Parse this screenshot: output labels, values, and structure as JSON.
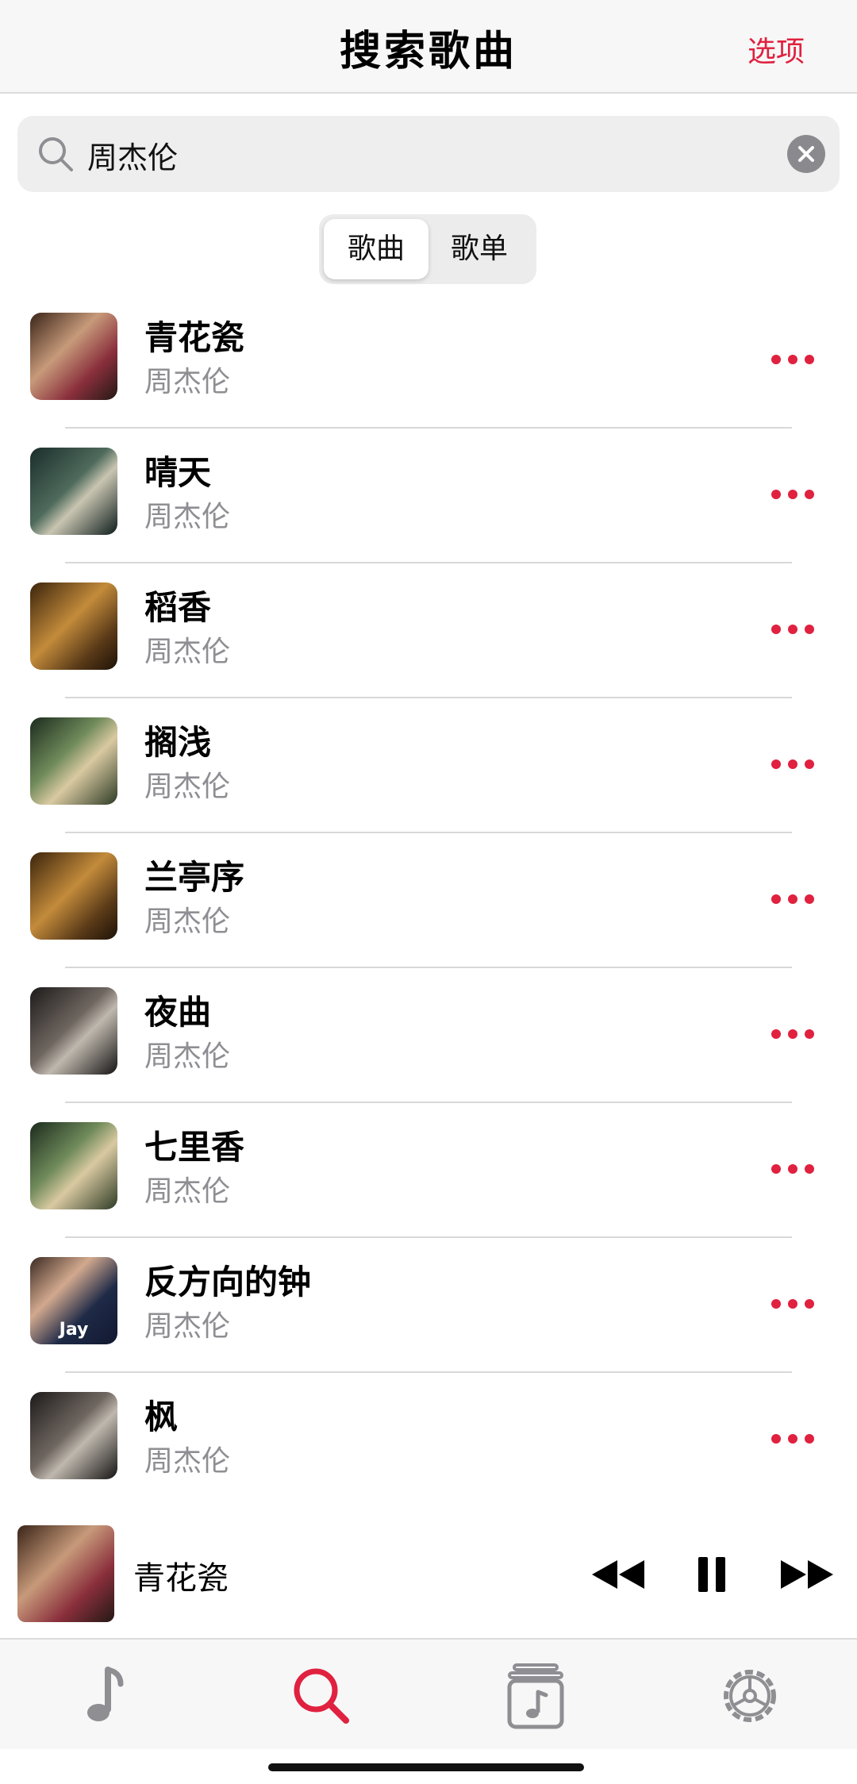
{
  "header": {
    "title": "搜索歌曲",
    "options_label": "选项"
  },
  "search": {
    "query": "周杰伦"
  },
  "segments": {
    "songs_label": "歌曲",
    "playlists_label": "歌单",
    "active": "歌曲"
  },
  "songs": [
    {
      "title": "青花瓷",
      "artist": "周杰伦",
      "cover": "c0",
      "cover_text": ""
    },
    {
      "title": "晴天",
      "artist": "周杰伦",
      "cover": "c1",
      "cover_text": ""
    },
    {
      "title": "稻香",
      "artist": "周杰伦",
      "cover": "c2",
      "cover_text": ""
    },
    {
      "title": "搁浅",
      "artist": "周杰伦",
      "cover": "c3",
      "cover_text": ""
    },
    {
      "title": "兰亭序",
      "artist": "周杰伦",
      "cover": "c2",
      "cover_text": ""
    },
    {
      "title": "夜曲",
      "artist": "周杰伦",
      "cover": "c4",
      "cover_text": ""
    },
    {
      "title": "七里香",
      "artist": "周杰伦",
      "cover": "c3",
      "cover_text": ""
    },
    {
      "title": "反方向的钟",
      "artist": "周杰伦",
      "cover": "c5",
      "cover_text": "Jay"
    },
    {
      "title": "枫",
      "artist": "周杰伦",
      "cover": "c4",
      "cover_text": ""
    }
  ],
  "now_playing": {
    "title": "青花瓷"
  },
  "tabs": [
    {
      "icon": "music-note-icon",
      "active": false
    },
    {
      "icon": "search-icon",
      "active": true
    },
    {
      "icon": "playlist-icon",
      "active": false
    },
    {
      "icon": "settings-icon",
      "active": false
    }
  ],
  "colors": {
    "accent": "#e0213f",
    "secondary_text": "#8e8e93",
    "inactive_icon": "#8e8e93"
  }
}
